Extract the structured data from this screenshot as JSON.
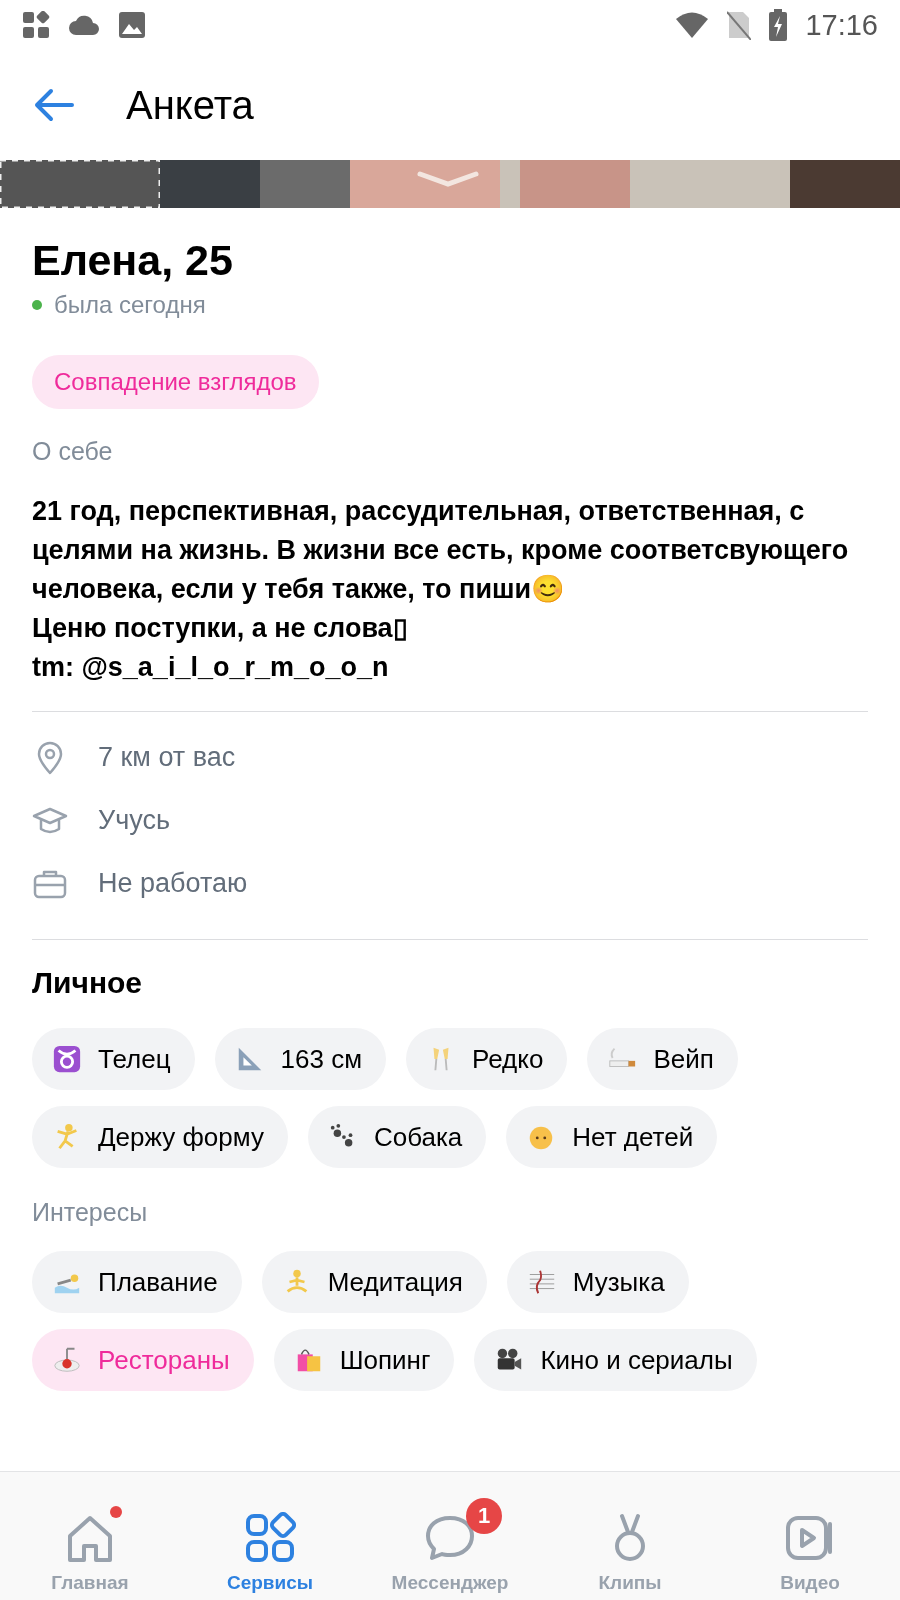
{
  "status_bar": {
    "time": "17:16"
  },
  "header": {
    "title": "Анкета"
  },
  "profile": {
    "name": "Елена, 25",
    "last_seen": "была сегодня",
    "online": true
  },
  "match_badge": "Совпадение взглядов",
  "about": {
    "label": "О себе",
    "lines": [
      "21 год, перспективная, рассудительная, ответственная, с целями на жизнь. В жизни все есть, кроме соответсвующего человека, если у тебя также, то пиши😊",
      "Ценю поступки, а не слова▯",
      "tm: @s_a_i_l_o_r_m_o_o_n"
    ]
  },
  "info": [
    {
      "kind": "location",
      "text": "7 км от вас"
    },
    {
      "kind": "study",
      "text": "Учусь"
    },
    {
      "kind": "work",
      "text": "Не работаю"
    }
  ],
  "personal": {
    "title": "Личное",
    "chips": [
      {
        "label": "Телец",
        "matched": false
      },
      {
        "label": "163 см",
        "matched": false
      },
      {
        "label": "Редко",
        "matched": false
      },
      {
        "label": "Вейп",
        "matched": false
      },
      {
        "label": "Держу форму",
        "matched": false
      },
      {
        "label": "Собака",
        "matched": false
      },
      {
        "label": "Нет детей",
        "matched": false
      }
    ]
  },
  "interests": {
    "title": "Интересы",
    "chips": [
      {
        "label": "Плавание",
        "matched": false
      },
      {
        "label": "Медитация",
        "matched": false
      },
      {
        "label": "Музыка",
        "matched": false
      },
      {
        "label": "Рестораны",
        "matched": true
      },
      {
        "label": "Шопинг",
        "matched": false
      },
      {
        "label": "Кино и сериалы",
        "matched": false
      }
    ]
  },
  "bottom_nav": [
    {
      "label": "Главная",
      "selected": false,
      "dot": true
    },
    {
      "label": "Сервисы",
      "selected": true,
      "dot": false
    },
    {
      "label": "Мессенджер",
      "selected": false,
      "dot": false,
      "badge": "1"
    },
    {
      "label": "Клипы",
      "selected": false,
      "dot": false
    },
    {
      "label": "Видео",
      "selected": false,
      "dot": false
    }
  ]
}
